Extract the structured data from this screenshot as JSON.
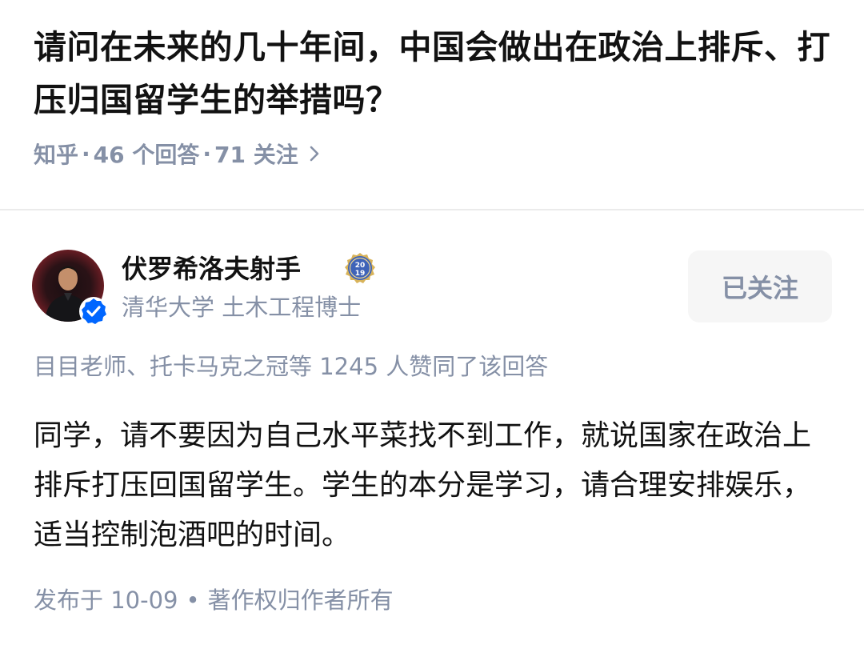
{
  "question": {
    "title": "请问在未来的几十年间，中国会做出在政治上排斥、打压归国留学生的举措吗？",
    "source": "知乎",
    "answers": "46 个回答",
    "followers": "71 关注",
    "dot": "·"
  },
  "icons": {
    "meta_chevron": "chevron-right-icon",
    "verified": "verified-check-icon",
    "badge": "anniversary-2019-badge-icon"
  },
  "author": {
    "name": "伏罗希洛夫射手",
    "headline": "清华大学 土木工程博士",
    "badge_year": "2019",
    "follow_label": "已关注"
  },
  "voters_text": "目目老师、托卡马克之冠等 1245 人赞同了该回答",
  "answer": {
    "body": "同学，请不要因为自己水平菜找不到工作，就说国家在政治上排斥打压回国留学生。学生的本分是学习，请合理安排娱乐，适当控制泡酒吧的时间。",
    "published": "发布于 10-09",
    "separator": "•",
    "copyright": "著作权归作者所有"
  },
  "colors": {
    "text_primary": "#121212",
    "text_secondary": "#8590a6",
    "verified_blue": "#0066ff",
    "button_bg": "#f6f6f6",
    "divider": "#ebebeb"
  }
}
